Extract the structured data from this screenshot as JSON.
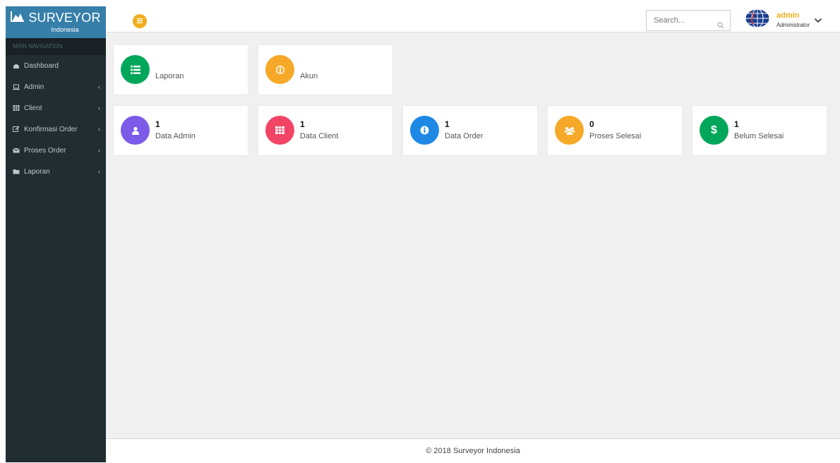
{
  "brand": {
    "title": "SURVEYOR",
    "subtitle": "Indonesia"
  },
  "sidebar": {
    "header": "MAIN NAVIGATION",
    "items": [
      {
        "label": "Dashboard",
        "icon": "dashboard-icon",
        "has_chevron": false
      },
      {
        "label": "Admin",
        "icon": "laptop-icon",
        "has_chevron": true
      },
      {
        "label": "Client",
        "icon": "grid-icon",
        "has_chevron": true
      },
      {
        "label": "Konfirmasi Order",
        "icon": "edit-icon",
        "has_chevron": true
      },
      {
        "label": "Proses Order",
        "icon": "envelope-icon",
        "has_chevron": true
      },
      {
        "label": "Laporan",
        "icon": "folder-icon",
        "has_chevron": true
      }
    ]
  },
  "topbar": {
    "search_placeholder": "Search...",
    "user": {
      "name": "admin",
      "role": "Administrator"
    }
  },
  "shortcuts": [
    {
      "label": "Laporan",
      "icon": "list-icon",
      "color": "#00a65a"
    },
    {
      "label": "Akun",
      "icon": "user-circle-icon",
      "color": "#f6a928"
    }
  ],
  "stats": [
    {
      "value": "1",
      "label": "Data Admin",
      "icon": "user-icon",
      "color": "#7b5be8"
    },
    {
      "value": "1",
      "label": "Data Client",
      "icon": "grid-icon",
      "color": "#f24566"
    },
    {
      "value": "1",
      "label": "Data Order",
      "icon": "info-icon",
      "color": "#1e88e5"
    },
    {
      "value": "0",
      "label": "Proses Selesai",
      "icon": "users-icon",
      "color": "#f6a928"
    },
    {
      "value": "1",
      "label": "Belum Selesai",
      "icon": "dollar-icon",
      "color": "#00a65a"
    }
  ],
  "footer": {
    "text": "© 2018 Surveyor Indonesia"
  },
  "colors": {
    "sidebar": "#222d32",
    "brand": "#367fa9",
    "accent": "#f0ad1e",
    "content_bg": "#f0f0f0"
  }
}
